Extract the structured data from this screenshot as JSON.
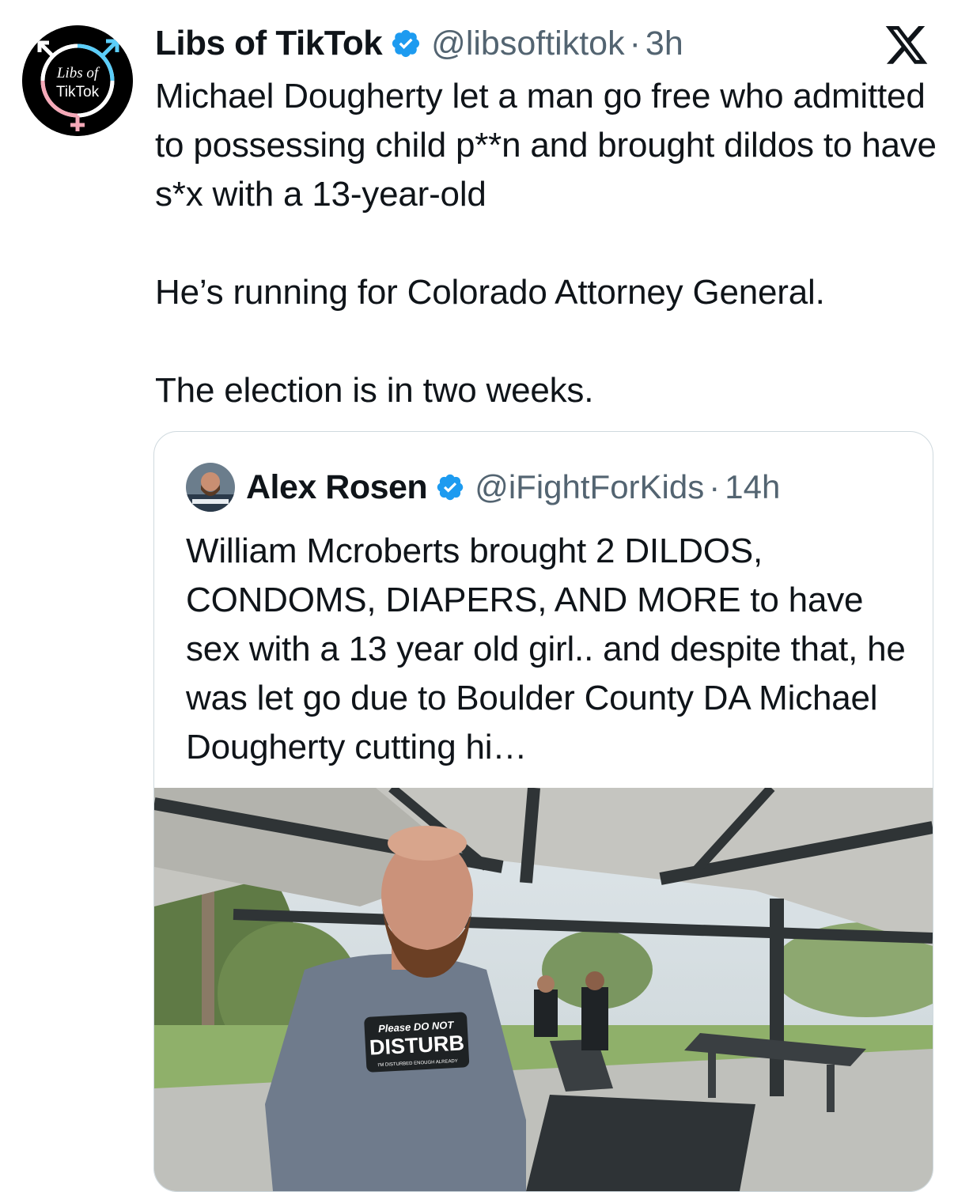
{
  "tweet": {
    "avatar": {
      "logo_text_line1": "Libs of",
      "logo_text_line2": "TikTok",
      "icon": "gender-symbols-logo-icon"
    },
    "author_name": "Libs of TikTok",
    "verified_icon": "verified-badge-icon",
    "handle": "@libsoftiktok",
    "separator": "·",
    "time": "3h",
    "platform_icon": "x-logo-icon",
    "text_paragraphs": [
      "Michael Dougherty let a man go free who admitted to possessing child p**n and brought dildos to have s*x with a 13-year-old",
      "He’s running for Colorado Attorney General.",
      "The election is in two weeks."
    ]
  },
  "quoted_tweet": {
    "author_name": "Alex Rosen",
    "verified_icon": "verified-badge-icon",
    "handle": "@iFightForKids",
    "separator": "·",
    "time": "14h",
    "text": "William Mcroberts brought 2 DILDOS, CONDOMS, DIAPERS, AND MORE to have sex with a 13 year old girl.. and despite that, he was let go due to Boulder County DA Michael Dougherty cutting hi…",
    "media": {
      "icon": "video-thumbnail-icon",
      "shirt_text_line1": "Please DO NOT",
      "shirt_text_line2": "DISTURB",
      "shirt_text_line3": "I'M DISTURBED ENOUGH ALREADY"
    }
  },
  "colors": {
    "text": "#0f1419",
    "secondary": "#536471",
    "verified": "#1d9bf0",
    "border": "#cfd9de"
  }
}
